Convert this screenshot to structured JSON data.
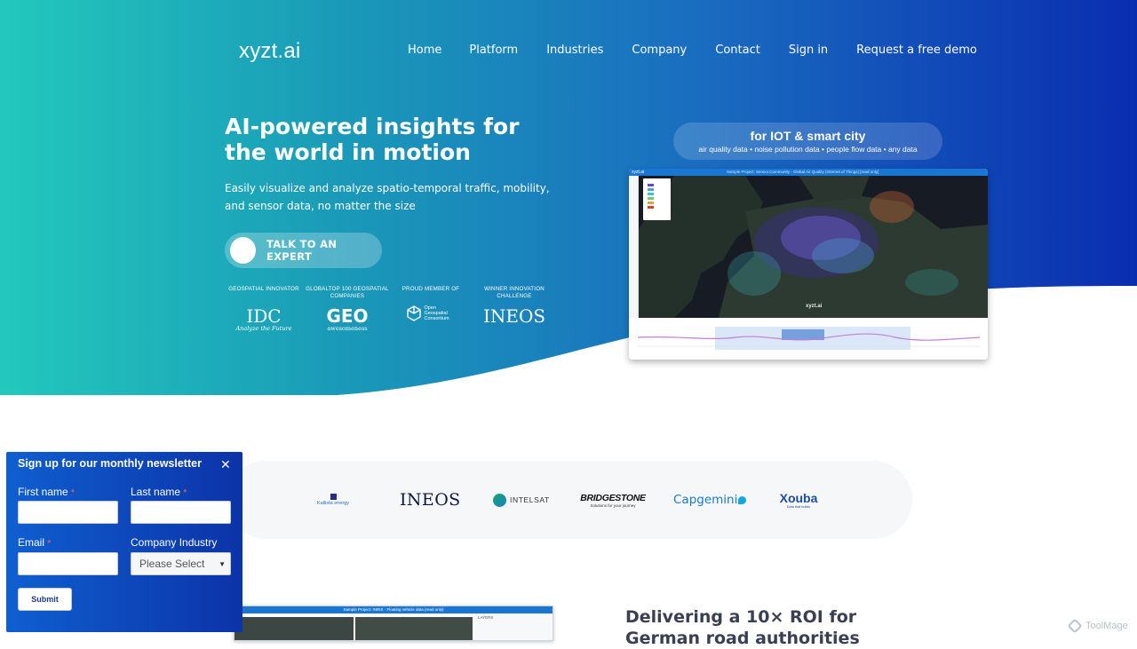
{
  "header": {
    "logo": "xyzt.ai",
    "nav": [
      "Home",
      "Platform",
      "Industries",
      "Company",
      "Contact",
      "Sign in",
      "Request a free demo"
    ]
  },
  "hero": {
    "headline": "AI-powered insights for the world in motion",
    "subline": "Easily visualize and analyze spatio-temporal traffic, mobility, and sensor data, no matter the size",
    "cta_label": "TALK TO AN EXPERT",
    "awards": [
      {
        "caption": "GEOSPATIAL INNOVATOR",
        "logo": "IDC",
        "sub": "Analyze the Future"
      },
      {
        "caption": "GLOBALTOP 100 GEOSPATIAL COMPANIES",
        "logo": "GEO",
        "sub": "awesomeness"
      },
      {
        "caption": "PROUD MEMBER OF",
        "logo": "Open Geospatial Consortium",
        "sub": ""
      },
      {
        "caption": "WINNER INNOVATION CHALLENGE",
        "logo": "INEOS",
        "sub": ""
      }
    ],
    "iot": {
      "title": "for IOT & smart city",
      "subtitle": "air quality data • noise pollution data • people flow data • any data"
    },
    "screenshot": {
      "app_name": "xyzt.ai",
      "project_title": "Sample Project: Sensor.Community - Global Air Quality (Internet of Things) [read only]",
      "watermark": "xyzt.ai"
    }
  },
  "clients": {
    "logos": [
      "Kallista energy",
      "INEOS",
      "INTELSAT",
      "BRIDGESTONE",
      "Capgemini",
      "Xouba"
    ],
    "bridgestone_tagline": "Solutions for your journey",
    "xouba_tagline": "Data that builds"
  },
  "case_study": {
    "title": "Delivering a 10× ROI for German road authorities",
    "thumb_title": "Sample Project: INRIX - Floating vehicle data (read only)",
    "thumb_panel": "LAYERS"
  },
  "newsletter": {
    "title": "Sign up for our monthly newsletter",
    "close": "✕",
    "first_name_label": "First name",
    "last_name_label": "Last name",
    "email_label": "Email",
    "industry_label": "Company Industry",
    "required_mark": "*",
    "industry_selected": "Please Select",
    "submit_label": "Submit"
  },
  "watermark": {
    "text": "ToolMage"
  }
}
